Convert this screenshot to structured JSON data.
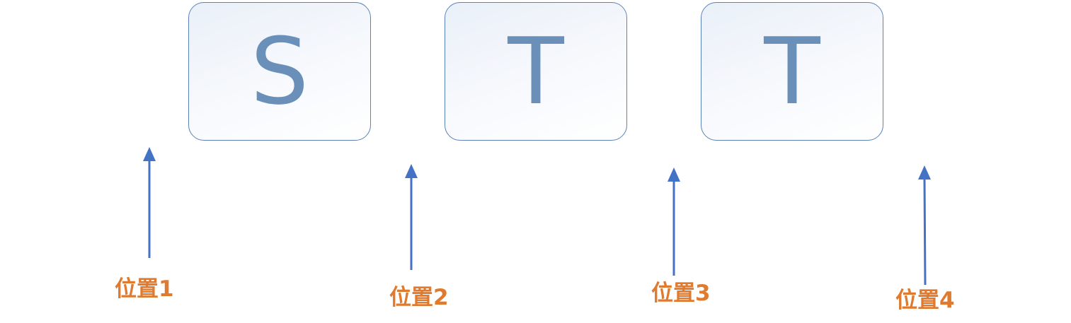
{
  "boxes": [
    {
      "letter": "S"
    },
    {
      "letter": "T"
    },
    {
      "letter": "T"
    }
  ],
  "positions": [
    {
      "label": "位置1"
    },
    {
      "label": "位置2"
    },
    {
      "label": "位置3"
    },
    {
      "label": "位置4"
    }
  ],
  "colors": {
    "box_border": "#5b82b8",
    "letter": "#6a8fb8",
    "arrow": "#4472c4",
    "label": "#e07a2e"
  }
}
